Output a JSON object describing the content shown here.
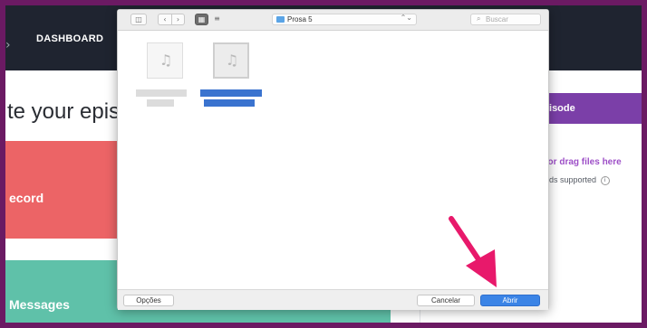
{
  "app": {
    "nav": {
      "edge_glyph": "›",
      "dashboard_label": "DASHBOARD"
    },
    "page_heading": "te your epis",
    "cards": {
      "record_label": "ecord",
      "messages_label": "Messages"
    },
    "side_panel": {
      "header_label": "e episode",
      "upload_link": "oad or drag files here",
      "multi_uploads": "uploads supported"
    }
  },
  "dialog": {
    "toolbar": {
      "sidebar_toggle_glyph": "◫",
      "back_glyph": "‹",
      "forward_glyph": "›",
      "icon_view_glyph": "▦",
      "list_view_glyph": "≡",
      "folder_name": "Prosa 5",
      "folder_arrows": "⌃⌄",
      "search_placeholder": "Buscar"
    },
    "files": [
      {
        "icon": "music-note-icon",
        "glyph": "♫",
        "selected": false
      },
      {
        "icon": "music-note-icon",
        "glyph": "♫",
        "selected": true
      }
    ],
    "footer": {
      "options_label": "Opções",
      "cancel_label": "Cancelar",
      "open_label": "Abrir"
    }
  },
  "colors": {
    "frame": "#6b1a63",
    "topbar": "#1f2430",
    "record_card": "#ec6466",
    "messages_card": "#5fc1a9",
    "side_header": "#7b3fa8",
    "arrow": "#e8196b",
    "primary_button": "#3b84e6"
  }
}
